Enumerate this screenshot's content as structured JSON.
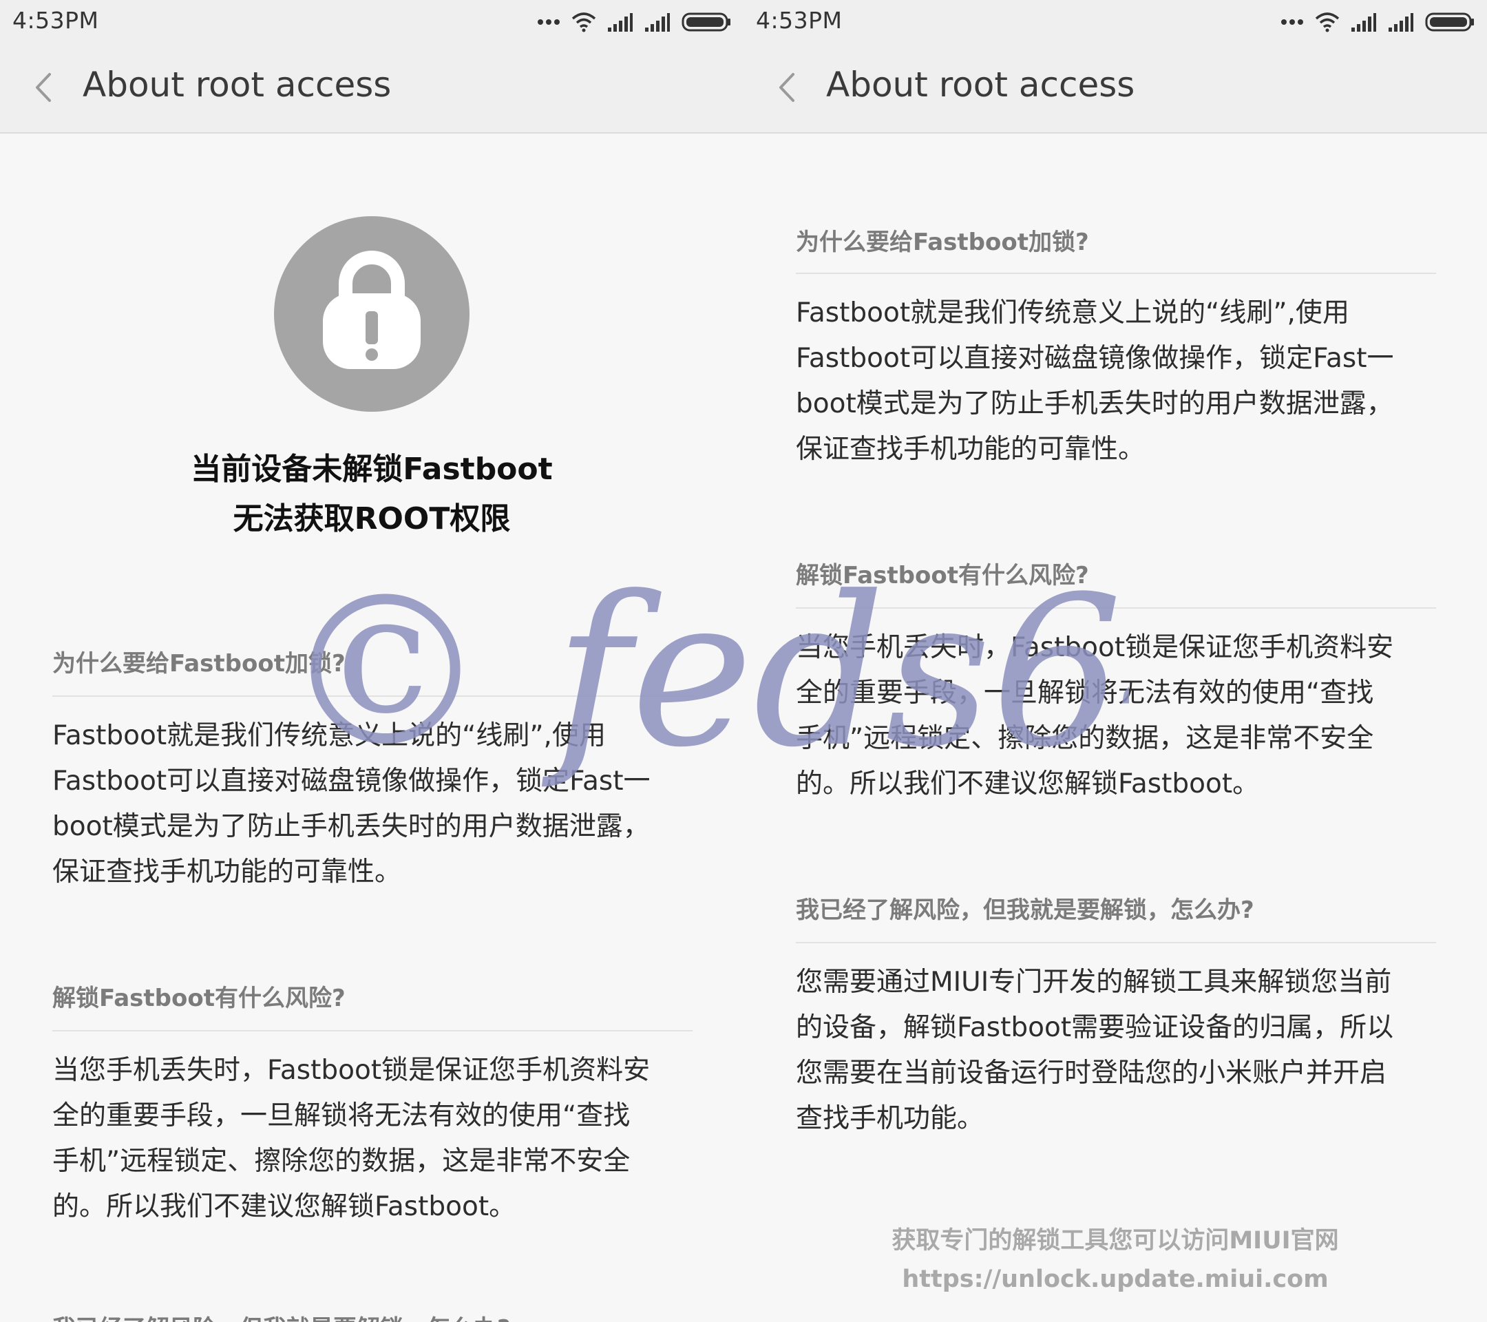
{
  "status_bar": {
    "time": "4:53PM",
    "icons": [
      "more-dots-icon",
      "wifi-icon",
      "signal-icon",
      "signal-icon",
      "battery-icon"
    ]
  },
  "header": {
    "back_icon": "chevron-left-icon",
    "title": "About root access"
  },
  "lock_icon": "lock-warning-icon",
  "headline": {
    "line1": "当前设备未解锁Fastboot",
    "line2": "无法获取ROOT权限"
  },
  "sections": [
    {
      "title": "为什么要给Fastboot加锁?",
      "lines": [
        "Fastboot就是我们传统意义上说的“线刷”,使用",
        "Fastboot可以直接对磁盘镜像做操作，锁定Fast一",
        "boot模式是为了防止手机丢失时的用户数据泄露，",
        "保证查找手机功能的可靠性。"
      ]
    },
    {
      "title": "解锁Fastboot有什么风险?",
      "lines": [
        "当您手机丢失时，Fastboot锁是保证您手机资料安",
        "全的重要手段，一旦解锁将无法有效的使用“查找",
        "手机”远程锁定、擦除您的数据，这是非常不安全",
        "的。所以我们不建议您解锁Fastboot。"
      ]
    },
    {
      "title": "我已经了解风险，但我就是要解锁，怎么办?",
      "lines": [
        "您需要通过MIUI专门开发的解锁工具来解锁您当前",
        "的设备，解锁Fastboot需要验证设备的归属，所以",
        "您需要在当前设备运行时登陆您的小米账户并开启",
        "查找手机功能。"
      ]
    }
  ],
  "footer": {
    "line1": "获取专门的解锁工具您可以访问MIUI官网",
    "line2": "https://unlock.update.miui.com"
  },
  "watermark": {
    "text": "© feds64",
    "color": "#8c8fbd"
  }
}
